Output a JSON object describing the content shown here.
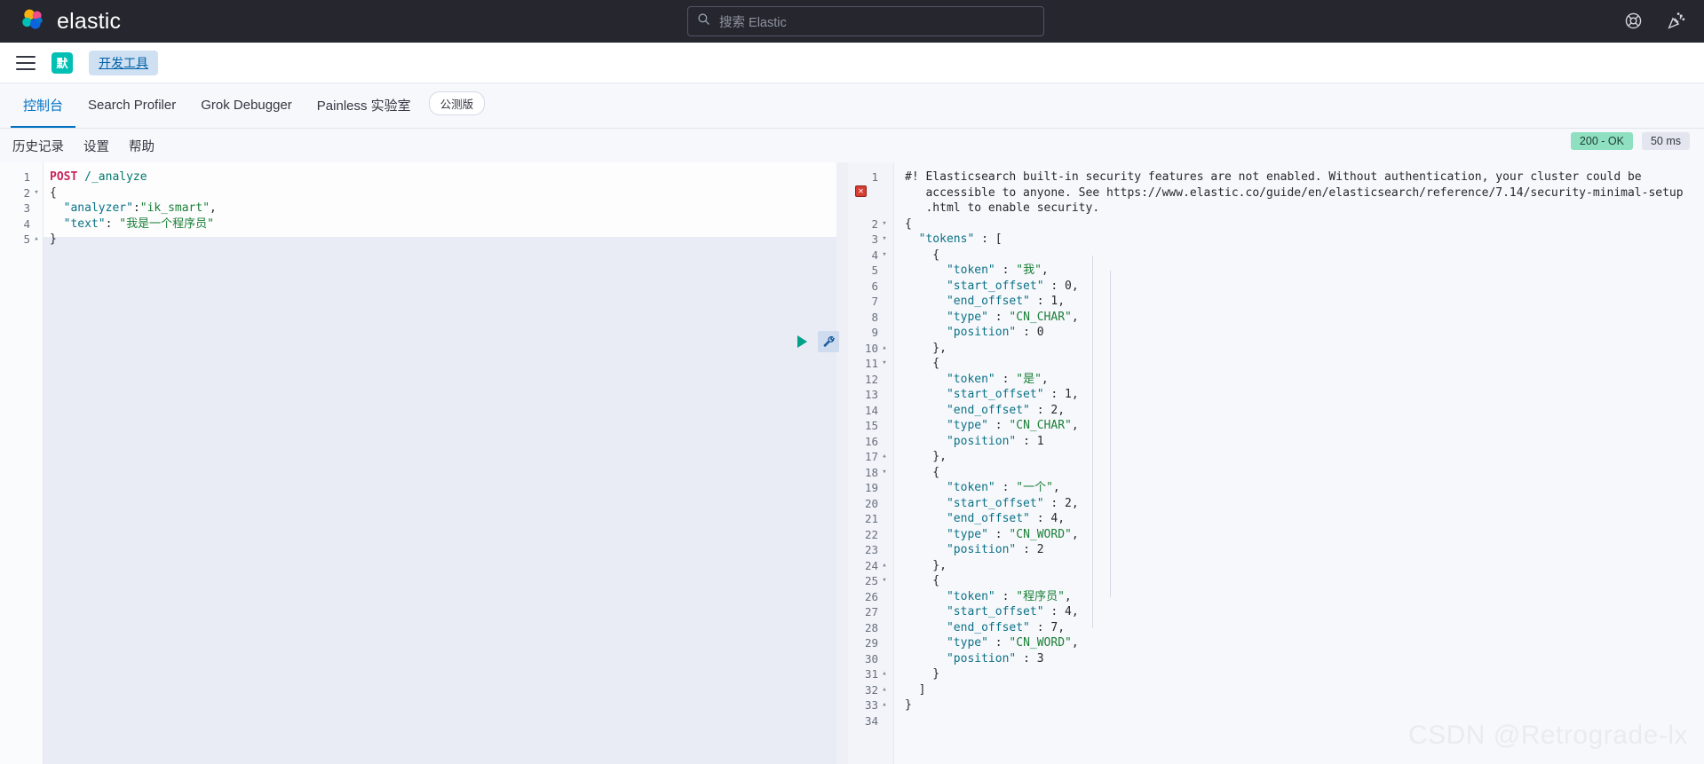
{
  "header": {
    "brand": "elastic",
    "search_placeholder": "搜索 Elastic",
    "search_icon": "search-icon",
    "help_icon": "lifebuoy-help-icon",
    "news_icon": "party-popper-news-icon"
  },
  "navbar": {
    "menu_icon": "hamburger-menu-icon",
    "space_initial": "默",
    "breadcrumb": "开发工具"
  },
  "tabs": [
    {
      "label": "控制台",
      "active": true
    },
    {
      "label": "Search Profiler",
      "active": false
    },
    {
      "label": "Grok Debugger",
      "active": false
    },
    {
      "label": "Painless 实验室",
      "active": false
    }
  ],
  "beta_pill": "公测版",
  "console_toolbar": {
    "history": "历史记录",
    "settings": "设置",
    "help": "帮助",
    "status_badge": "200 - OK",
    "time_badge": "50 ms",
    "status_color": "#8fe0c0",
    "play_icon": "play-run-request-icon",
    "wrench_icon": "wrench-settings-icon"
  },
  "request_editor": {
    "lines": [
      {
        "n": "1",
        "fold": "",
        "segments": [
          {
            "t": "POST",
            "c": "tk-method"
          },
          {
            "t": " ",
            "c": "tk-plain"
          },
          {
            "t": "/_analyze",
            "c": "tk-url"
          }
        ]
      },
      {
        "n": "2",
        "fold": "▾",
        "segments": [
          {
            "t": "{",
            "c": "tk-punc"
          }
        ]
      },
      {
        "n": "3",
        "fold": "",
        "segments": [
          {
            "t": "  ",
            "c": "tk-plain"
          },
          {
            "t": "\"analyzer\"",
            "c": "tk-key"
          },
          {
            "t": ":",
            "c": "tk-punc"
          },
          {
            "t": "\"ik_smart\"",
            "c": "tk-str"
          },
          {
            "t": ",",
            "c": "tk-punc"
          }
        ]
      },
      {
        "n": "4",
        "fold": "",
        "segments": [
          {
            "t": "  ",
            "c": "tk-plain"
          },
          {
            "t": "\"text\"",
            "c": "tk-key"
          },
          {
            "t": ": ",
            "c": "tk-punc"
          },
          {
            "t": "\"我是一个程序员\"",
            "c": "tk-str"
          }
        ]
      },
      {
        "n": "5",
        "fold": "▴",
        "segments": [
          {
            "t": "}",
            "c": "tk-punc"
          }
        ]
      }
    ]
  },
  "response_editor": {
    "lines": [
      {
        "n": "1",
        "fold": "",
        "segments": [
          {
            "t": "#! Elasticsearch built-in security features are not enabled. Without authentication, your cluster could be",
            "c": "tk-warn"
          }
        ]
      },
      {
        "n": "",
        "fold": "",
        "segments": [
          {
            "t": "   accessible to anyone. See https://www.elastic.co/guide/en/elasticsearch/reference/7.14/security-minimal-setup",
            "c": "tk-warn"
          }
        ]
      },
      {
        "n": "",
        "fold": "",
        "segments": [
          {
            "t": "   .html to enable security.",
            "c": "tk-warn"
          }
        ]
      },
      {
        "n": "2",
        "fold": "▾",
        "segments": [
          {
            "t": "{",
            "c": "tk-punc"
          }
        ]
      },
      {
        "n": "3",
        "fold": "▾",
        "segments": [
          {
            "t": "  ",
            "c": "tk-plain"
          },
          {
            "t": "\"tokens\"",
            "c": "tk-key"
          },
          {
            "t": " : [",
            "c": "tk-punc"
          }
        ]
      },
      {
        "n": "4",
        "fold": "▾",
        "segments": [
          {
            "t": "    {",
            "c": "tk-punc"
          }
        ]
      },
      {
        "n": "5",
        "fold": "",
        "segments": [
          {
            "t": "      ",
            "c": "tk-plain"
          },
          {
            "t": "\"token\"",
            "c": "tk-key"
          },
          {
            "t": " : ",
            "c": "tk-punc"
          },
          {
            "t": "\"我\"",
            "c": "tk-str"
          },
          {
            "t": ",",
            "c": "tk-punc"
          }
        ]
      },
      {
        "n": "6",
        "fold": "",
        "segments": [
          {
            "t": "      ",
            "c": "tk-plain"
          },
          {
            "t": "\"start_offset\"",
            "c": "tk-key"
          },
          {
            "t": " : ",
            "c": "tk-punc"
          },
          {
            "t": "0",
            "c": "tk-num"
          },
          {
            "t": ",",
            "c": "tk-punc"
          }
        ]
      },
      {
        "n": "7",
        "fold": "",
        "segments": [
          {
            "t": "      ",
            "c": "tk-plain"
          },
          {
            "t": "\"end_offset\"",
            "c": "tk-key"
          },
          {
            "t": " : ",
            "c": "tk-punc"
          },
          {
            "t": "1",
            "c": "tk-num"
          },
          {
            "t": ",",
            "c": "tk-punc"
          }
        ]
      },
      {
        "n": "8",
        "fold": "",
        "segments": [
          {
            "t": "      ",
            "c": "tk-plain"
          },
          {
            "t": "\"type\"",
            "c": "tk-key"
          },
          {
            "t": " : ",
            "c": "tk-punc"
          },
          {
            "t": "\"CN_CHAR\"",
            "c": "tk-str"
          },
          {
            "t": ",",
            "c": "tk-punc"
          }
        ]
      },
      {
        "n": "9",
        "fold": "",
        "segments": [
          {
            "t": "      ",
            "c": "tk-plain"
          },
          {
            "t": "\"position\"",
            "c": "tk-key"
          },
          {
            "t": " : ",
            "c": "tk-punc"
          },
          {
            "t": "0",
            "c": "tk-num"
          }
        ]
      },
      {
        "n": "10",
        "fold": "▴",
        "segments": [
          {
            "t": "    },",
            "c": "tk-punc"
          }
        ]
      },
      {
        "n": "11",
        "fold": "▾",
        "segments": [
          {
            "t": "    {",
            "c": "tk-punc"
          }
        ]
      },
      {
        "n": "12",
        "fold": "",
        "segments": [
          {
            "t": "      ",
            "c": "tk-plain"
          },
          {
            "t": "\"token\"",
            "c": "tk-key"
          },
          {
            "t": " : ",
            "c": "tk-punc"
          },
          {
            "t": "\"是\"",
            "c": "tk-str"
          },
          {
            "t": ",",
            "c": "tk-punc"
          }
        ]
      },
      {
        "n": "13",
        "fold": "",
        "segments": [
          {
            "t": "      ",
            "c": "tk-plain"
          },
          {
            "t": "\"start_offset\"",
            "c": "tk-key"
          },
          {
            "t": " : ",
            "c": "tk-punc"
          },
          {
            "t": "1",
            "c": "tk-num"
          },
          {
            "t": ",",
            "c": "tk-punc"
          }
        ]
      },
      {
        "n": "14",
        "fold": "",
        "segments": [
          {
            "t": "      ",
            "c": "tk-plain"
          },
          {
            "t": "\"end_offset\"",
            "c": "tk-key"
          },
          {
            "t": " : ",
            "c": "tk-punc"
          },
          {
            "t": "2",
            "c": "tk-num"
          },
          {
            "t": ",",
            "c": "tk-punc"
          }
        ]
      },
      {
        "n": "15",
        "fold": "",
        "segments": [
          {
            "t": "      ",
            "c": "tk-plain"
          },
          {
            "t": "\"type\"",
            "c": "tk-key"
          },
          {
            "t": " : ",
            "c": "tk-punc"
          },
          {
            "t": "\"CN_CHAR\"",
            "c": "tk-str"
          },
          {
            "t": ",",
            "c": "tk-punc"
          }
        ]
      },
      {
        "n": "16",
        "fold": "",
        "segments": [
          {
            "t": "      ",
            "c": "tk-plain"
          },
          {
            "t": "\"position\"",
            "c": "tk-key"
          },
          {
            "t": " : ",
            "c": "tk-punc"
          },
          {
            "t": "1",
            "c": "tk-num"
          }
        ]
      },
      {
        "n": "17",
        "fold": "▴",
        "segments": [
          {
            "t": "    },",
            "c": "tk-punc"
          }
        ]
      },
      {
        "n": "18",
        "fold": "▾",
        "segments": [
          {
            "t": "    {",
            "c": "tk-punc"
          }
        ]
      },
      {
        "n": "19",
        "fold": "",
        "segments": [
          {
            "t": "      ",
            "c": "tk-plain"
          },
          {
            "t": "\"token\"",
            "c": "tk-key"
          },
          {
            "t": " : ",
            "c": "tk-punc"
          },
          {
            "t": "\"一个\"",
            "c": "tk-str"
          },
          {
            "t": ",",
            "c": "tk-punc"
          }
        ]
      },
      {
        "n": "20",
        "fold": "",
        "segments": [
          {
            "t": "      ",
            "c": "tk-plain"
          },
          {
            "t": "\"start_offset\"",
            "c": "tk-key"
          },
          {
            "t": " : ",
            "c": "tk-punc"
          },
          {
            "t": "2",
            "c": "tk-num"
          },
          {
            "t": ",",
            "c": "tk-punc"
          }
        ]
      },
      {
        "n": "21",
        "fold": "",
        "segments": [
          {
            "t": "      ",
            "c": "tk-plain"
          },
          {
            "t": "\"end_offset\"",
            "c": "tk-key"
          },
          {
            "t": " : ",
            "c": "tk-punc"
          },
          {
            "t": "4",
            "c": "tk-num"
          },
          {
            "t": ",",
            "c": "tk-punc"
          }
        ]
      },
      {
        "n": "22",
        "fold": "",
        "segments": [
          {
            "t": "      ",
            "c": "tk-plain"
          },
          {
            "t": "\"type\"",
            "c": "tk-key"
          },
          {
            "t": " : ",
            "c": "tk-punc"
          },
          {
            "t": "\"CN_WORD\"",
            "c": "tk-str"
          },
          {
            "t": ",",
            "c": "tk-punc"
          }
        ]
      },
      {
        "n": "23",
        "fold": "",
        "segments": [
          {
            "t": "      ",
            "c": "tk-plain"
          },
          {
            "t": "\"position\"",
            "c": "tk-key"
          },
          {
            "t": " : ",
            "c": "tk-punc"
          },
          {
            "t": "2",
            "c": "tk-num"
          }
        ]
      },
      {
        "n": "24",
        "fold": "▴",
        "segments": [
          {
            "t": "    },",
            "c": "tk-punc"
          }
        ]
      },
      {
        "n": "25",
        "fold": "▾",
        "segments": [
          {
            "t": "    {",
            "c": "tk-punc"
          }
        ]
      },
      {
        "n": "26",
        "fold": "",
        "segments": [
          {
            "t": "      ",
            "c": "tk-plain"
          },
          {
            "t": "\"token\"",
            "c": "tk-key"
          },
          {
            "t": " : ",
            "c": "tk-punc"
          },
          {
            "t": "\"程序员\"",
            "c": "tk-str"
          },
          {
            "t": ",",
            "c": "tk-punc"
          }
        ]
      },
      {
        "n": "27",
        "fold": "",
        "segments": [
          {
            "t": "      ",
            "c": "tk-plain"
          },
          {
            "t": "\"start_offset\"",
            "c": "tk-key"
          },
          {
            "t": " : ",
            "c": "tk-punc"
          },
          {
            "t": "4",
            "c": "tk-num"
          },
          {
            "t": ",",
            "c": "tk-punc"
          }
        ]
      },
      {
        "n": "28",
        "fold": "",
        "segments": [
          {
            "t": "      ",
            "c": "tk-plain"
          },
          {
            "t": "\"end_offset\"",
            "c": "tk-key"
          },
          {
            "t": " : ",
            "c": "tk-punc"
          },
          {
            "t": "7",
            "c": "tk-num"
          },
          {
            "t": ",",
            "c": "tk-punc"
          }
        ]
      },
      {
        "n": "29",
        "fold": "",
        "segments": [
          {
            "t": "      ",
            "c": "tk-plain"
          },
          {
            "t": "\"type\"",
            "c": "tk-key"
          },
          {
            "t": " : ",
            "c": "tk-punc"
          },
          {
            "t": "\"CN_WORD\"",
            "c": "tk-str"
          },
          {
            "t": ",",
            "c": "tk-punc"
          }
        ]
      },
      {
        "n": "30",
        "fold": "",
        "segments": [
          {
            "t": "      ",
            "c": "tk-plain"
          },
          {
            "t": "\"position\"",
            "c": "tk-key"
          },
          {
            "t": " : ",
            "c": "tk-punc"
          },
          {
            "t": "3",
            "c": "tk-num"
          }
        ]
      },
      {
        "n": "31",
        "fold": "▴",
        "segments": [
          {
            "t": "    }",
            "c": "tk-punc"
          }
        ]
      },
      {
        "n": "32",
        "fold": "▴",
        "segments": [
          {
            "t": "  ]",
            "c": "tk-punc"
          }
        ]
      },
      {
        "n": "33",
        "fold": "▴",
        "segments": [
          {
            "t": "}",
            "c": "tk-punc"
          }
        ]
      },
      {
        "n": "34",
        "fold": "",
        "segments": []
      }
    ]
  },
  "watermark": "CSDN @Retrograde-lx"
}
